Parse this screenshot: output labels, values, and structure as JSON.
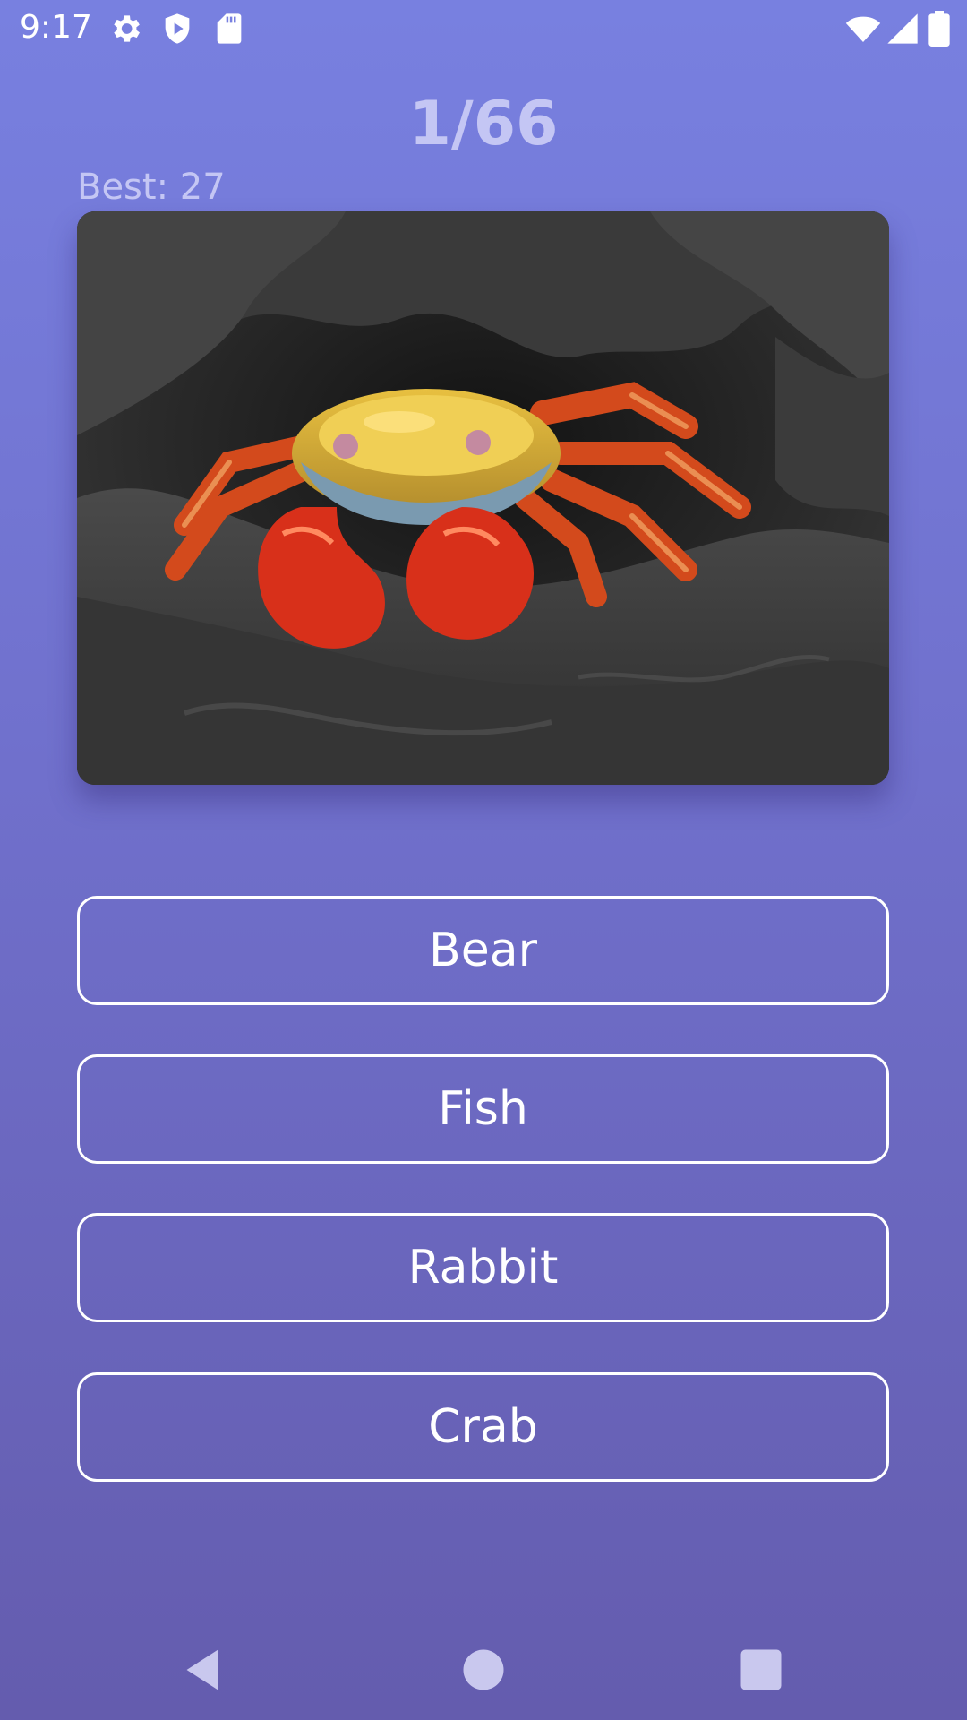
{
  "status_bar": {
    "time": "9:17",
    "icons_left": [
      "settings-gear-icon",
      "play-shield-icon",
      "sd-card-icon"
    ],
    "icons_right": [
      "wifi-icon",
      "cellular-signal-icon",
      "battery-icon"
    ]
  },
  "quiz": {
    "progress": "1/66",
    "best_label": "Best:",
    "best_value": "27"
  },
  "photo": {
    "subject": "crab-photo"
  },
  "answers": [
    {
      "label": "Bear"
    },
    {
      "label": "Fish"
    },
    {
      "label": "Rabbit"
    },
    {
      "label": "Crab"
    }
  ],
  "navigation": {
    "buttons": [
      "back-icon",
      "home-icon",
      "recents-icon"
    ]
  },
  "colors": {
    "background_top": "#7880e0",
    "background_bottom": "#645cae",
    "header_text": "#c4c6f4",
    "button_border": "#ffffff"
  }
}
